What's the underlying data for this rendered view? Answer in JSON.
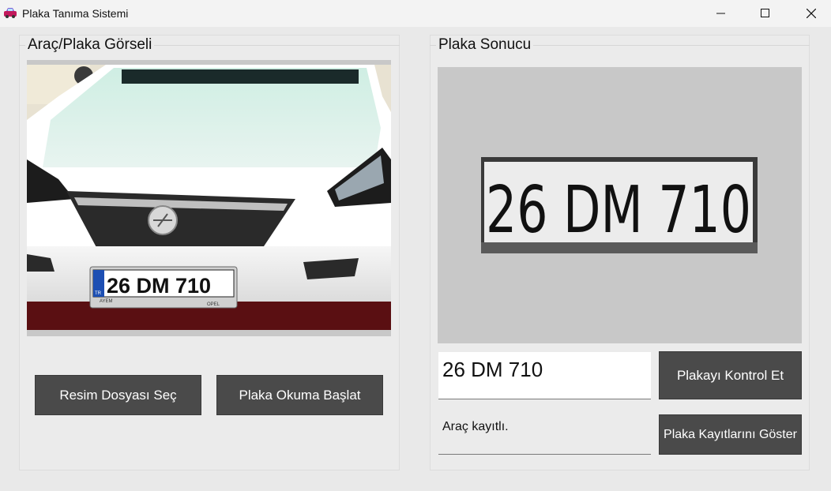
{
  "window": {
    "title": "Plaka Tanıma Sistemi",
    "icon": "car-icon",
    "controls": [
      "minimize-icon",
      "maximize-icon",
      "close-icon"
    ]
  },
  "left_panel": {
    "title": "Araç/Plaka Görseli",
    "image": {
      "description_icon": "car-photo",
      "plate_text": "26 DM 710",
      "plate_country": "TR",
      "badge_text": "AYEM",
      "brand_text": "OPEL"
    },
    "buttons": {
      "select_image": "Resim Dosyası Seç",
      "start_reading": "Plaka Okuma Başlat"
    }
  },
  "right_panel": {
    "title": "Plaka Sonucu",
    "plate_crop_text": "26 DM 710",
    "plate_value": "26 DM 710",
    "status_text": "Araç kayıtlı.",
    "buttons": {
      "check_plate": "Plakayı Kontrol Et",
      "show_records": "Plaka Kayıtlarını Göster"
    }
  },
  "colors": {
    "button_bg": "#4a4a4a",
    "button_text": "#ffffff",
    "window_bg": "#e9e9e9",
    "crop_bg": "#c8c8c8"
  }
}
